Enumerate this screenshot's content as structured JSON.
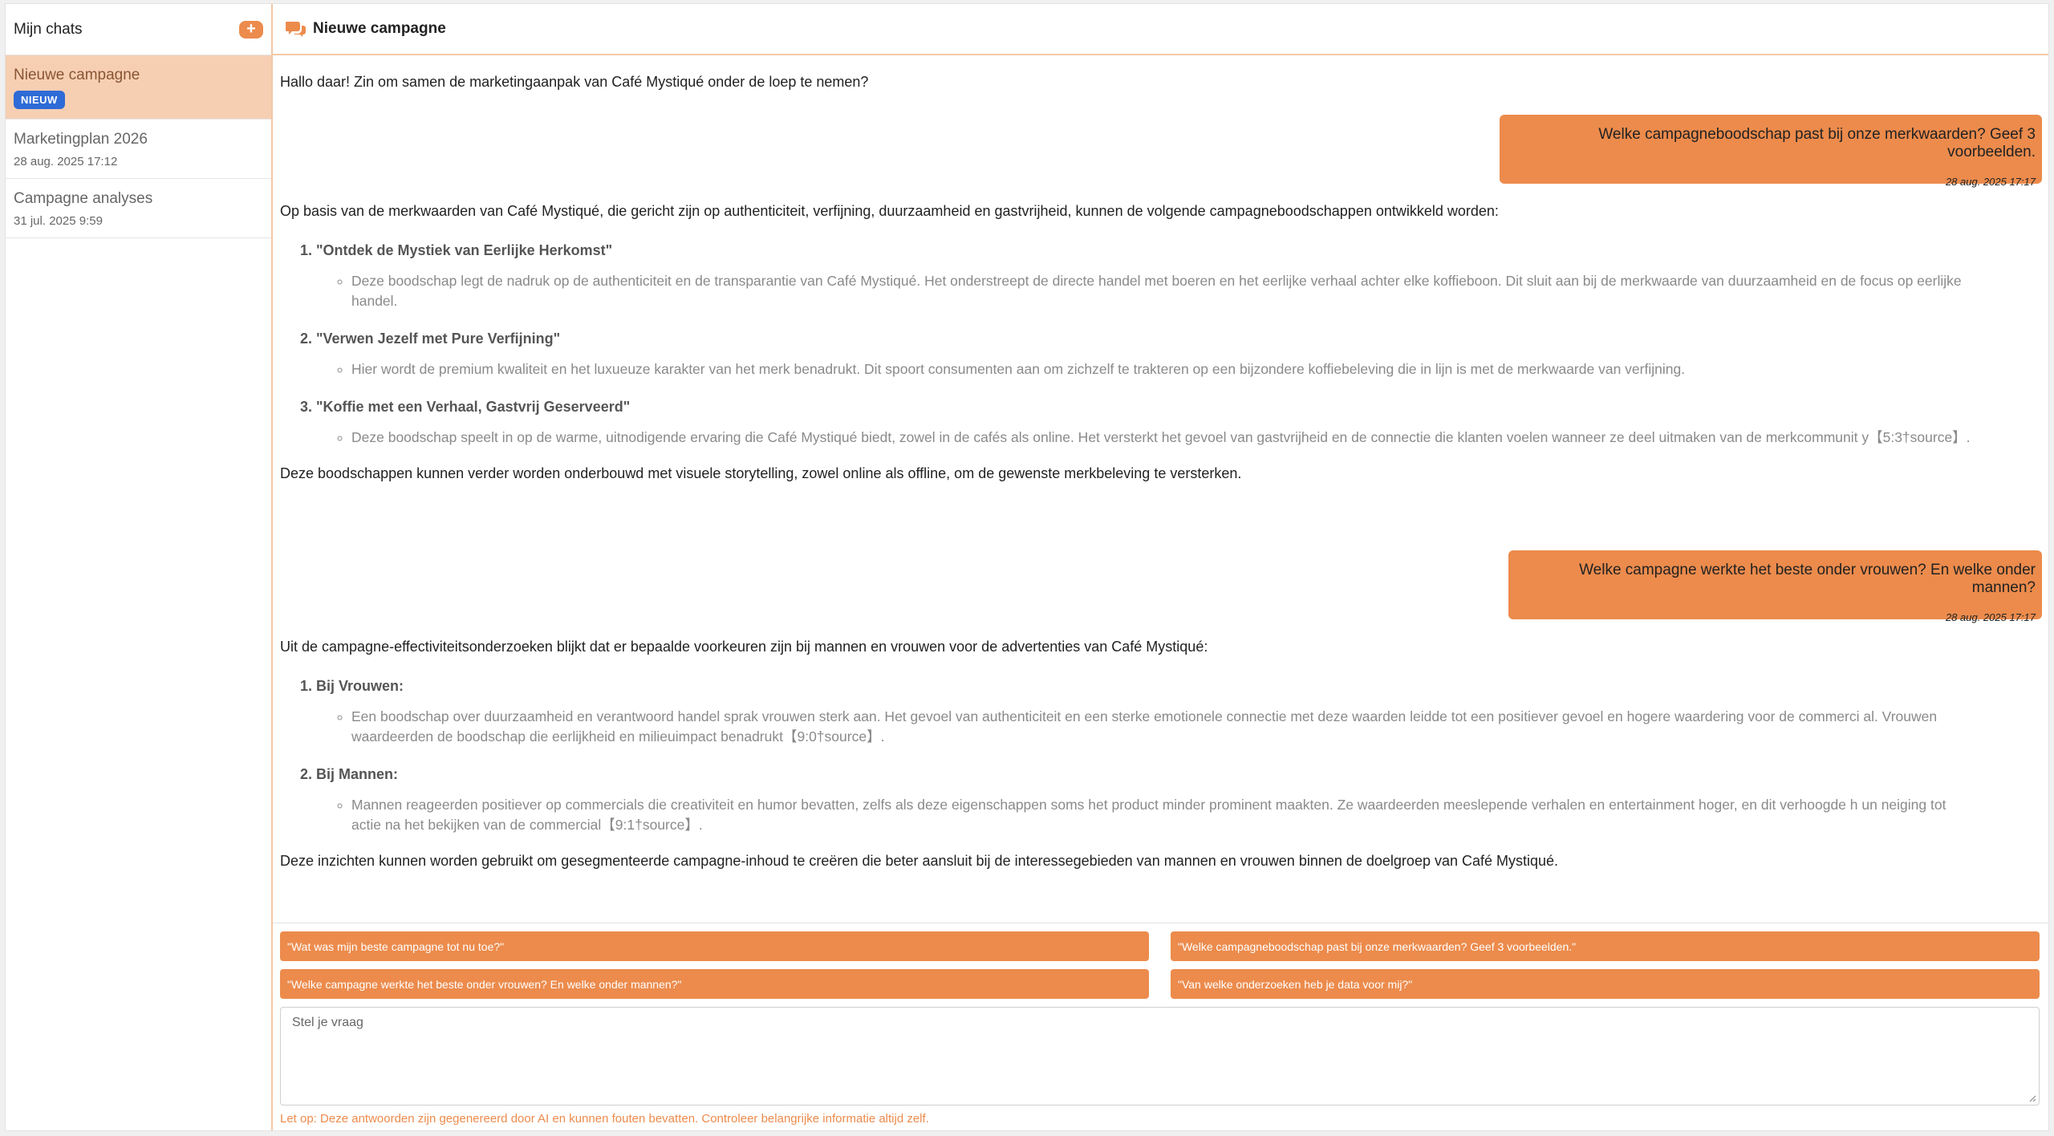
{
  "sidebar": {
    "title": "Mijn chats",
    "add_label": "+",
    "chats": [
      {
        "title": "Nieuwe campagne",
        "badge": "NIEUW",
        "date": ""
      },
      {
        "title": "Marketingplan 2026",
        "date": "28 aug. 2025 17:12"
      },
      {
        "title": "Campagne analyses",
        "date": "31 jul. 2025 9:59"
      }
    ]
  },
  "header": {
    "title": "Nieuwe campagne",
    "icon": "chat-bubbles-icon"
  },
  "messages": {
    "greeting": "Hallo daar! Zin om samen de marketingaanpak van Café Mystiqué onder de loep te nemen?",
    "user1": {
      "text": "Welke campagneboodschap past bij onze merkwaarden? Geef 3 voorbeelden.",
      "time": "28 aug. 2025 17:17"
    },
    "answer1": {
      "intro": "Op basis van de merkwaarden van Café Mystiqué, die gericht zijn op authenticiteit, verfijning, duurzaamheid en gastvrijheid, kunnen de volgende campagneboodschappen ontwikkeld worden:",
      "items": [
        {
          "title": "\"Ontdek de Mystiek van Eerlijke Herkomst\"",
          "detail": "Deze boodschap legt de nadruk op de authenticiteit en de transparantie van Café Mystiqué. Het onderstreept de directe handel met boeren en het eerlijke verhaal achter elke koffieboon. Dit sluit aan bij de merkwaarde van duurzaamheid en de focus op eerlijke handel."
        },
        {
          "title": "\"Verwen Jezelf met Pure Verfijning\"",
          "detail": "Hier wordt de premium kwaliteit en het luxueuze karakter van het merk benadrukt. Dit spoort consumenten aan om zichzelf te trakteren op een bijzondere koffiebeleving die in lijn is met de merkwaarde van verfijning."
        },
        {
          "title": "\"Koffie met een Verhaal, Gastvrij Geserveerd\"",
          "detail": "Deze boodschap speelt in op de warme, uitnodigende ervaring die Café Mystiqué biedt, zowel in de cafés als online. Het versterkt het gevoel van gastvrijheid en de connectie die klanten voelen wanneer ze deel uitmaken van de merkcommunit y【5:3†source】."
        }
      ],
      "outro": "Deze boodschappen kunnen verder worden onderbouwd met visuele storytelling, zowel online als offline, om de gewenste merkbeleving te versterken."
    },
    "user2": {
      "text": "Welke campagne werkte het beste onder vrouwen? En welke onder mannen?",
      "time": "28 aug. 2025 17:17"
    },
    "answer2": {
      "intro": "Uit de campagne-effectiviteitsonderzoeken blijkt dat er bepaalde voorkeuren zijn bij mannen en vrouwen voor de advertenties van Café Mystiqué:",
      "items": [
        {
          "title": "Bij Vrouwen:",
          "detail": "Een boodschap over duurzaamheid en verantwoord handel sprak vrouwen sterk aan. Het gevoel van authenticiteit en een sterke emotionele connectie met deze waarden leidde tot een positiever gevoel en hogere waardering voor de commerci al. Vrouwen waardeerden de boodschap die eerlijkheid en milieuimpact benadrukt【9:0†source】."
        },
        {
          "title": "Bij Mannen:",
          "detail": "Mannen reageerden positiever op commercials die creativiteit en humor bevatten, zelfs als deze eigenschappen soms het product minder prominent maakten. Ze waardeerden meeslepende verhalen en entertainment hoger, en dit verhoogde h un neiging tot actie na het bekijken van de commercial【9:1†source】."
        }
      ],
      "outro": "Deze inzichten kunnen worden gebruikt om gesegmenteerde campagne-inhoud te creëren die beter aansluit bij de interessegebieden van mannen en vrouwen binnen de doelgroep van Café Mystiqué."
    }
  },
  "suggestions": [
    "\"Wat was mijn beste campagne tot nu toe?\"",
    "\"Welke campagneboodschap past bij onze merkwaarden? Geef 3 voorbeelden.\"",
    "\"Welke campagne werkte het beste onder vrouwen? En welke onder mannen?\"",
    "\"Van welke onderzoeken heb je data voor mij?\""
  ],
  "input": {
    "placeholder": "Stel je vraag"
  },
  "disclaimer": "Let op: Deze antwoorden zijn gegenereerd door AI en kunnen fouten bevatten. Controleer belangrijke informatie altijd zelf.",
  "colors": {
    "accent": "#ec8b4c",
    "active_chat": "#f6cfb3",
    "badge": "#2e6bd6"
  }
}
